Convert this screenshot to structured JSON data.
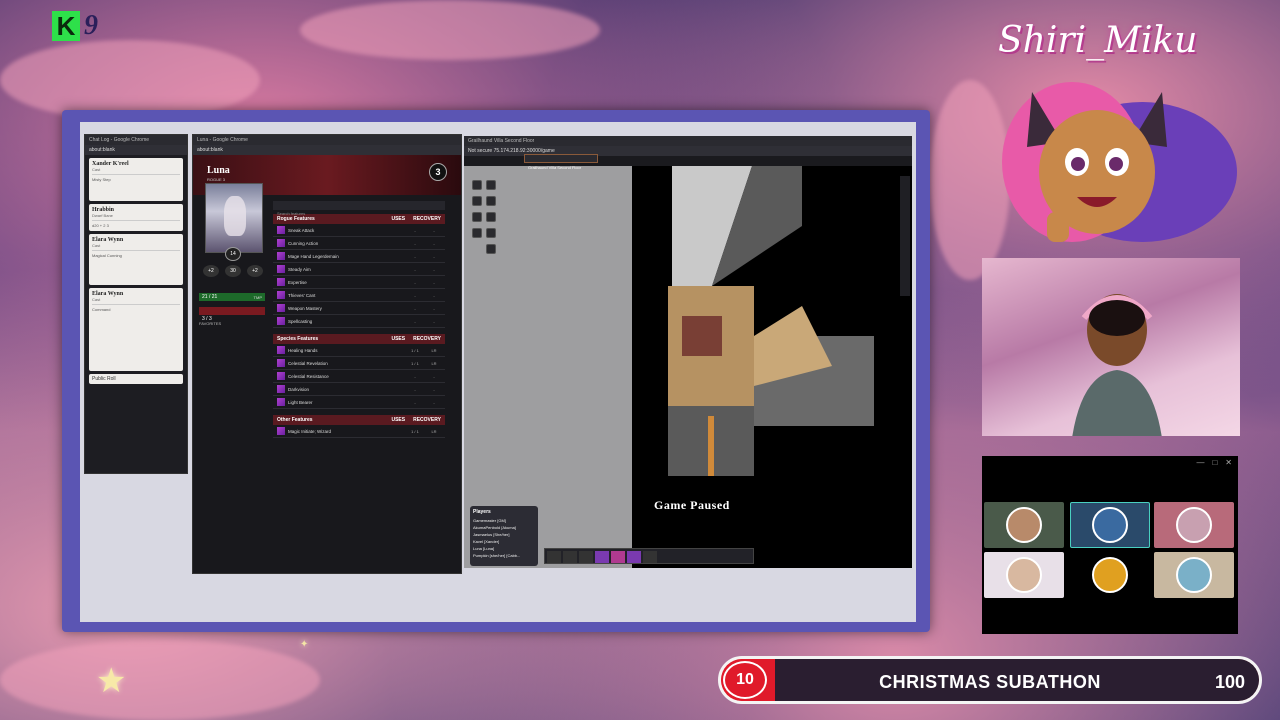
{
  "overlay": {
    "logo_letter": "K",
    "logo_number": "9",
    "streamer_name": "Shiri_Miku"
  },
  "chat_window": {
    "tab_title": "Chat Log - Google Chrome",
    "url": "about:blank",
    "cards": [
      {
        "name": "Xander K'reel",
        "sub": "Cast",
        "detail": "Misty Step"
      },
      {
        "name": "Hrabbin",
        "sub": "Dwarf Bane",
        "detail": "d20 + 2  3"
      },
      {
        "name": "Elara Wynn",
        "sub": "Cast",
        "detail": "Magical Cunning"
      },
      {
        "name": "Elara Wynn",
        "sub": "Cast",
        "detail": "Command"
      }
    ],
    "public_roll": "Public Roll"
  },
  "sheet_window": {
    "tab_title": "Luna - Google Chrome",
    "url": "about:blank",
    "character_name": "Luna",
    "character_class": "ROGUE 3",
    "level": "3",
    "search_placeholder": "Search features",
    "portrait_level": "14",
    "mods": [
      "+2",
      "30",
      "+2"
    ],
    "hp": "21 / 21",
    "temp": "TMP",
    "hit_dice": "3 / 3",
    "favorites": "FAVORITES",
    "sections": [
      {
        "title": "Rogue Features",
        "uses_label": "USES",
        "recovery_label": "RECOVERY",
        "items": [
          {
            "name": "Sneak Attack",
            "uses": "-",
            "recovery": "-"
          },
          {
            "name": "Cunning Action",
            "uses": "-",
            "recovery": "-"
          },
          {
            "name": "Mage Hand Legerdemain",
            "uses": "-",
            "recovery": "-"
          },
          {
            "name": "Steady Aim",
            "uses": "-",
            "recovery": "-"
          },
          {
            "name": "Expertise",
            "uses": "-",
            "recovery": "-"
          },
          {
            "name": "Thieves' Cant",
            "uses": "-",
            "recovery": "-"
          },
          {
            "name": "Weapon Mastery",
            "uses": "-",
            "recovery": "-"
          },
          {
            "name": "Spellcasting",
            "uses": "-",
            "recovery": "-"
          }
        ]
      },
      {
        "title": "Species Features",
        "uses_label": "USES",
        "recovery_label": "RECOVERY",
        "items": [
          {
            "name": "Healing Hands",
            "uses": "1 / 1",
            "recovery": "LR"
          },
          {
            "name": "Celestial Revelation",
            "uses": "1 / 1",
            "recovery": "LR"
          },
          {
            "name": "Celestial Resistance",
            "uses": "-",
            "recovery": "-"
          },
          {
            "name": "Darkvision",
            "uses": "-",
            "recovery": "-"
          },
          {
            "name": "Light Bearer",
            "uses": "-",
            "recovery": "-"
          }
        ]
      },
      {
        "title": "Other Features",
        "uses_label": "USES",
        "recovery_label": "RECOVERY",
        "items": [
          {
            "name": "Magic Initiate; Wizard",
            "uses": "1 / 1",
            "recovery": "LR"
          }
        ]
      }
    ]
  },
  "game_window": {
    "tab_title": "Grailhaund Villa Second Floor",
    "url": "Not secure  75.174.218.92:30000/game",
    "scene_name": "Grailhaund Villa Second Floor",
    "paused_text": "Game Paused",
    "players_title": "Players",
    "players": [
      "Gamemaster [GM]",
      "AkumaPenbold [Akuma]",
      "Jasmaelus [She/her]",
      "Kavel [Xander]",
      "Luna [Luna]",
      "Pumpkin [she/her] [Cabb..."
    ]
  },
  "subathon": {
    "current": "10",
    "title": "CHRISTMAS SUBATHON",
    "goal": "100",
    "progress_fraction": 0.1
  },
  "colors": {
    "frame": "#5b55b3",
    "subathon_red": "#e01a2a",
    "logo_green": "#2ee04a"
  }
}
